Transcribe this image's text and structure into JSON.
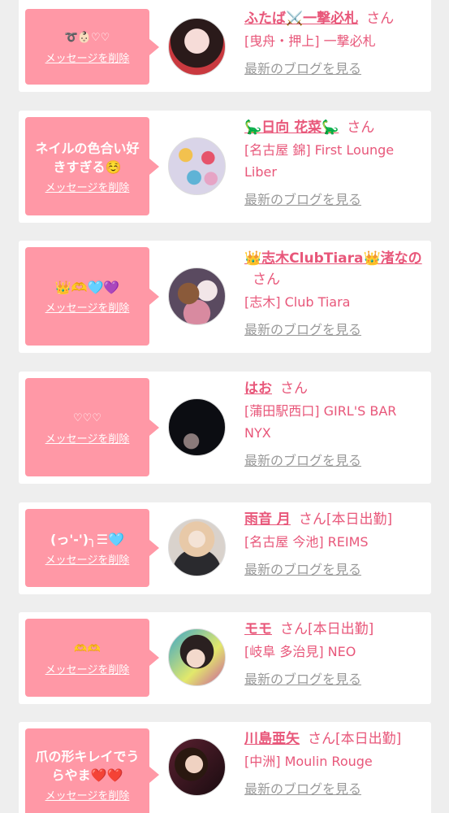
{
  "delete_label": "メッセージを削除",
  "blog_label": "最新のブログを見る",
  "san_label": "さん",
  "accent_color": "#e8577a",
  "bubble_color": "#ff98a6",
  "cards": [
    {
      "message": "➰👶🏻♡♡",
      "name": "ふたば⚔️一撃必札",
      "badge": "",
      "shop": "[曳舟・押上] 一撃必札",
      "avatar": "girl-photo-icon"
    },
    {
      "message": "ネイルの色合い好きすぎる☺️",
      "name": "🦕日向 花菜🦕",
      "badge": "",
      "shop": "[名古屋 錦] First Lounge Liber",
      "avatar": "girl-photo-icon"
    },
    {
      "message": "👑🫶🩵💜",
      "name": "👑志木ClubTiara👑渚なの",
      "badge": "",
      "shop": "[志木] Club Tiara",
      "avatar": "girl-photo-icon"
    },
    {
      "message": "♡♡♡",
      "name": "はお",
      "badge": "",
      "shop": "[蒲田駅西口] GIRL'S BAR NYX",
      "avatar": "girl-photo-icon"
    },
    {
      "message": "(っ'-')╮☰🩵",
      "name": "雨音 月",
      "badge": "[本日出勤]",
      "shop": "[名古屋 今池] REIMS",
      "avatar": "girl-photo-icon"
    },
    {
      "message": "🫶🫶",
      "name": "モモ",
      "badge": "[本日出勤]",
      "shop": "[岐阜 多治見] NEO",
      "avatar": "girl-photo-icon"
    },
    {
      "message": "爪の形キレイでうらやま❤️❤️",
      "name": "川島亜矢",
      "badge": "[本日出勤]",
      "shop": "[中洲] Moulin Rouge",
      "avatar": "girl-photo-icon"
    }
  ]
}
